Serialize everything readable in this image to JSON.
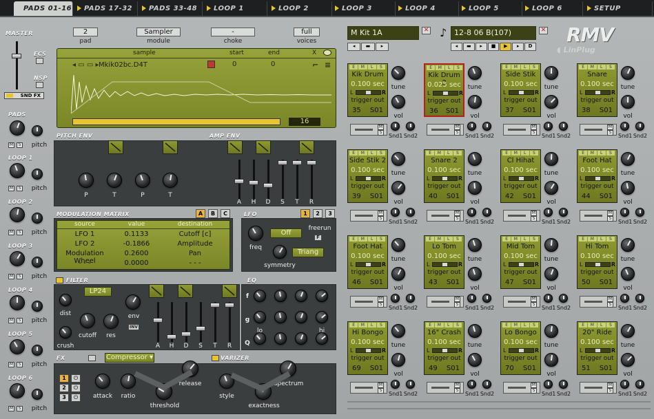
{
  "tabs": [
    "PADS 01-16",
    "PADS 17-32",
    "PADS 33-48",
    "LOOP 1",
    "LOOP 2",
    "LOOP 3",
    "LOOP 4",
    "LOOP 5",
    "LOOP 6",
    "SETUP"
  ],
  "left": {
    "master": "MASTER",
    "ecs": "ECS",
    "nsp": "NSP",
    "snd_fx": "SND FX",
    "pads": "PADS",
    "loops": [
      "LOOP 1",
      "LOOP 2",
      "LOOP 3",
      "LOOP 4",
      "LOOP 5",
      "LOOP 6"
    ],
    "pitch": "pitch",
    "m": "M",
    "s": "S"
  },
  "top": {
    "pad_value": "2",
    "pad_label": "pad",
    "module_value": "Sampler",
    "module_label": "module",
    "choke_value": "-",
    "choke_label": "choke",
    "voices_value": "full",
    "voices_label": "voices"
  },
  "sample": {
    "col_sample": "sample",
    "col_start": "start",
    "col_end": "end",
    "x": "X",
    "file": "Mkik02bc.D4T",
    "start": "0",
    "end": "0",
    "zoom": "16"
  },
  "pitchenv": {
    "title": "PITCH ENV",
    "labels": [
      "P",
      "T",
      "P",
      "T"
    ]
  },
  "ampenv": {
    "title": "AMP ENV",
    "labels": [
      "A",
      "H",
      "D",
      "S",
      "T",
      "R"
    ]
  },
  "modmatrix": {
    "title": "MODULATION MATRIX",
    "tabs": [
      "A",
      "B",
      "C"
    ],
    "headers": [
      "source",
      "value",
      "destination"
    ],
    "rows": [
      [
        "LFO 1",
        "0.1133",
        "Cutoff [c]"
      ],
      [
        "LFO 2",
        "-0.1866",
        "Amplitude"
      ],
      [
        "Modulation Wheel",
        "0.2600",
        "Pan"
      ],
      [
        "- - -",
        "0.0000",
        "- - -"
      ]
    ]
  },
  "lfo": {
    "title": "LFO",
    "tabs": [
      "1",
      "2",
      "3"
    ],
    "freq": "freq",
    "off": "Off",
    "freerun": "freerun",
    "f": "F",
    "symmetry": "symmetry",
    "wave": "Triang"
  },
  "filter": {
    "title": "FILTER",
    "type": "LP24",
    "dist": "dist",
    "crush": "crush",
    "cutoff": "cutoff",
    "res": "res",
    "env": "env",
    "inv": "INV",
    "sliders": [
      "A",
      "H",
      "D",
      "S",
      "T",
      "R"
    ]
  },
  "eq": {
    "title": "EQ",
    "rows": [
      "f",
      "g",
      "Q"
    ],
    "lo": "lo",
    "hi": "hi"
  },
  "fx": {
    "title": "FX",
    "effect": "Compressor",
    "slots": [
      "1",
      "2",
      "3"
    ],
    "attack": "attack",
    "ratio": "ratio",
    "threshold": "threshold",
    "release": "release"
  },
  "varizer": {
    "title": "VARIZER",
    "style": "style",
    "exactness": "exactness",
    "spectrum": "spectrum"
  },
  "kit": {
    "name": "M Kit 1A",
    "pattern": "12-8 06 B(107)",
    "logo": "RMV",
    "brand": "LinPlug"
  },
  "pads": [
    {
      "name": "Kik Drum",
      "dur": "0.100 sec",
      "num": "35",
      "out": "S01"
    },
    {
      "name": "Kik Drum 2",
      "dur": "0.025 sec",
      "num": "36",
      "out": "S01"
    },
    {
      "name": "Side Stik",
      "dur": "0.100 sec",
      "num": "37",
      "out": "S01"
    },
    {
      "name": "Snare",
      "dur": "0.100 sec",
      "num": "38",
      "out": "S01"
    },
    {
      "name": "Side Stik 2",
      "dur": "0.100 sec",
      "num": "39",
      "out": "S01"
    },
    {
      "name": "Snare 2",
      "dur": "0.100 sec",
      "num": "40",
      "out": "S01"
    },
    {
      "name": "Cl Hihat",
      "dur": "0.100 sec",
      "num": "42",
      "out": "S01"
    },
    {
      "name": "Foot Hat",
      "dur": "0.100 sec",
      "num": "44",
      "out": "S01"
    },
    {
      "name": "Foot Hat",
      "dur": "0.100 sec",
      "num": "46",
      "out": "S01"
    },
    {
      "name": "Lo Tom",
      "dur": "0.100 sec",
      "num": "43",
      "out": "S01"
    },
    {
      "name": "Mid Tom",
      "dur": "0.100 sec",
      "num": "47",
      "out": "S01"
    },
    {
      "name": "Hi Tom",
      "dur": "0.100 sec",
      "num": "50",
      "out": "S01"
    },
    {
      "name": "Hi Bongo",
      "dur": "0.100 sec",
      "num": "69",
      "out": "S01"
    },
    {
      "name": "16\" Crash",
      "dur": "0.100 sec",
      "num": "49",
      "out": "S01"
    },
    {
      "name": "Lo Bongo",
      "dur": "0.100 sec",
      "num": "70",
      "out": "S01"
    },
    {
      "name": "20\" Ride",
      "dur": "0.100 sec",
      "num": "51",
      "out": "S01"
    }
  ],
  "padtext": {
    "trigger_out": "trigger out",
    "tune": "tune",
    "vol": "vol",
    "snd1": "Snd1",
    "snd2": "Snd2",
    "l": "L",
    "r": "R",
    "hdr": [
      "E",
      "M",
      "L",
      "S"
    ]
  }
}
